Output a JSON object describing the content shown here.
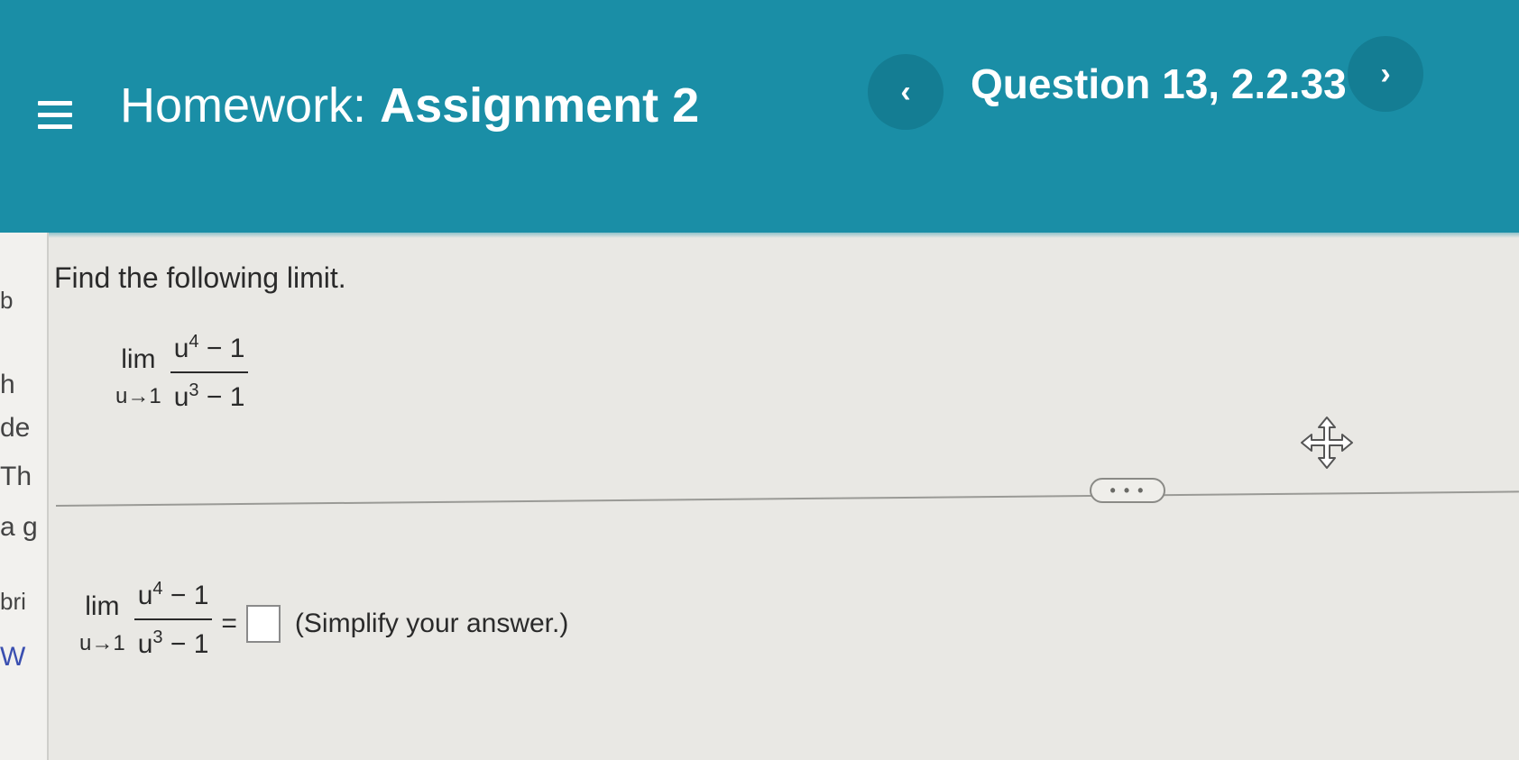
{
  "header": {
    "menu_icon": "hamburger-menu-icon",
    "title_prefix": "Homework:",
    "title_main": "Assignment 2",
    "prev_label": "‹",
    "next_label": "›",
    "question": "Question 13, 2.2.33"
  },
  "sidebar": {
    "fragments": [
      "b",
      "h",
      "de",
      "Th",
      "a g",
      "bri",
      "W"
    ]
  },
  "problem": {
    "instruction": "Find the following limit.",
    "limit": {
      "lim": "lim",
      "approach": "u→1",
      "numerator_base": "u",
      "numerator_exp": "4",
      "numerator_rest": " − 1",
      "denominator_base": "u",
      "denominator_exp": "3",
      "denominator_rest": " − 1"
    }
  },
  "more_button": "• • •",
  "answer": {
    "equals": "=",
    "value": "",
    "hint": "(Simplify your answer.)"
  },
  "colors": {
    "header_bg": "#1a8ea6",
    "page_bg": "#e9e8e4"
  }
}
